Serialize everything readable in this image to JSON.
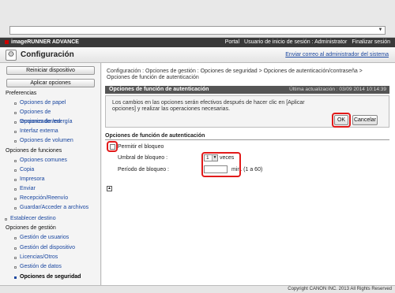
{
  "browser": {
    "url_value": ""
  },
  "topbar": {
    "brand": "imageRUNNER ADVANCE",
    "portal": "Portal",
    "user_info": "Usuario de inicio de sesión : Administrator",
    "logout": "Finalizar sesión"
  },
  "titlebar": {
    "title": "Configuración",
    "admin_link": "Enviar correo al administrador del sistema"
  },
  "sidebar": {
    "restart_button": "Reiniciar dispositivo",
    "apply_button": "Aplicar opciones",
    "groups": [
      {
        "label": "Preferencias",
        "items": [
          "Opciones de papel",
          "Opciones de temporizador/energía",
          "Opciones de red",
          "Interfaz externa",
          "Opciones de volumen"
        ]
      },
      {
        "label": "Opciones de funciones",
        "items": [
          "Opciones comunes",
          "Copia",
          "Impresora",
          "Enviar",
          "Recepción/Reenvío",
          "Guardar/Acceder a archivos"
        ]
      },
      {
        "label": "Establecer destino",
        "items": []
      },
      {
        "label": "Opciones de gestión",
        "items": [
          "Gestión de usuarios",
          "Gestión del dispositivo",
          "Licencias/Otros",
          "Gestión de datos",
          "Opciones de seguridad"
        ]
      }
    ]
  },
  "main": {
    "breadcrumb": "Configuración : Opciones de gestión : Opciones de seguridad > Opciones de autenticación/contraseña > Opciones de función de autenticación",
    "header_title": "Opciones de función de autenticación",
    "last_update": "Última actualización : 03/09 2014 10:14:39",
    "notice": "Los cambios en las opciones serán efectivos después de hacer clic en [Aplicar opciones] y realizar las operaciones necesarias.",
    "ok_button": "OK",
    "cancel_button": "Cancelar",
    "section_title": "Opciones de función de autenticación",
    "lockout_checkbox_label": "Permitir el bloqueo",
    "threshold_label": "Umbral de bloqueo :",
    "threshold_value": "1",
    "threshold_unit": "veces",
    "period_label": "Período de bloqueo :",
    "period_value": "",
    "period_unit": "min. (1 a 60)"
  },
  "footer": {
    "copyright": "Copyright CANON INC. 2013 All Rights Reserved"
  }
}
